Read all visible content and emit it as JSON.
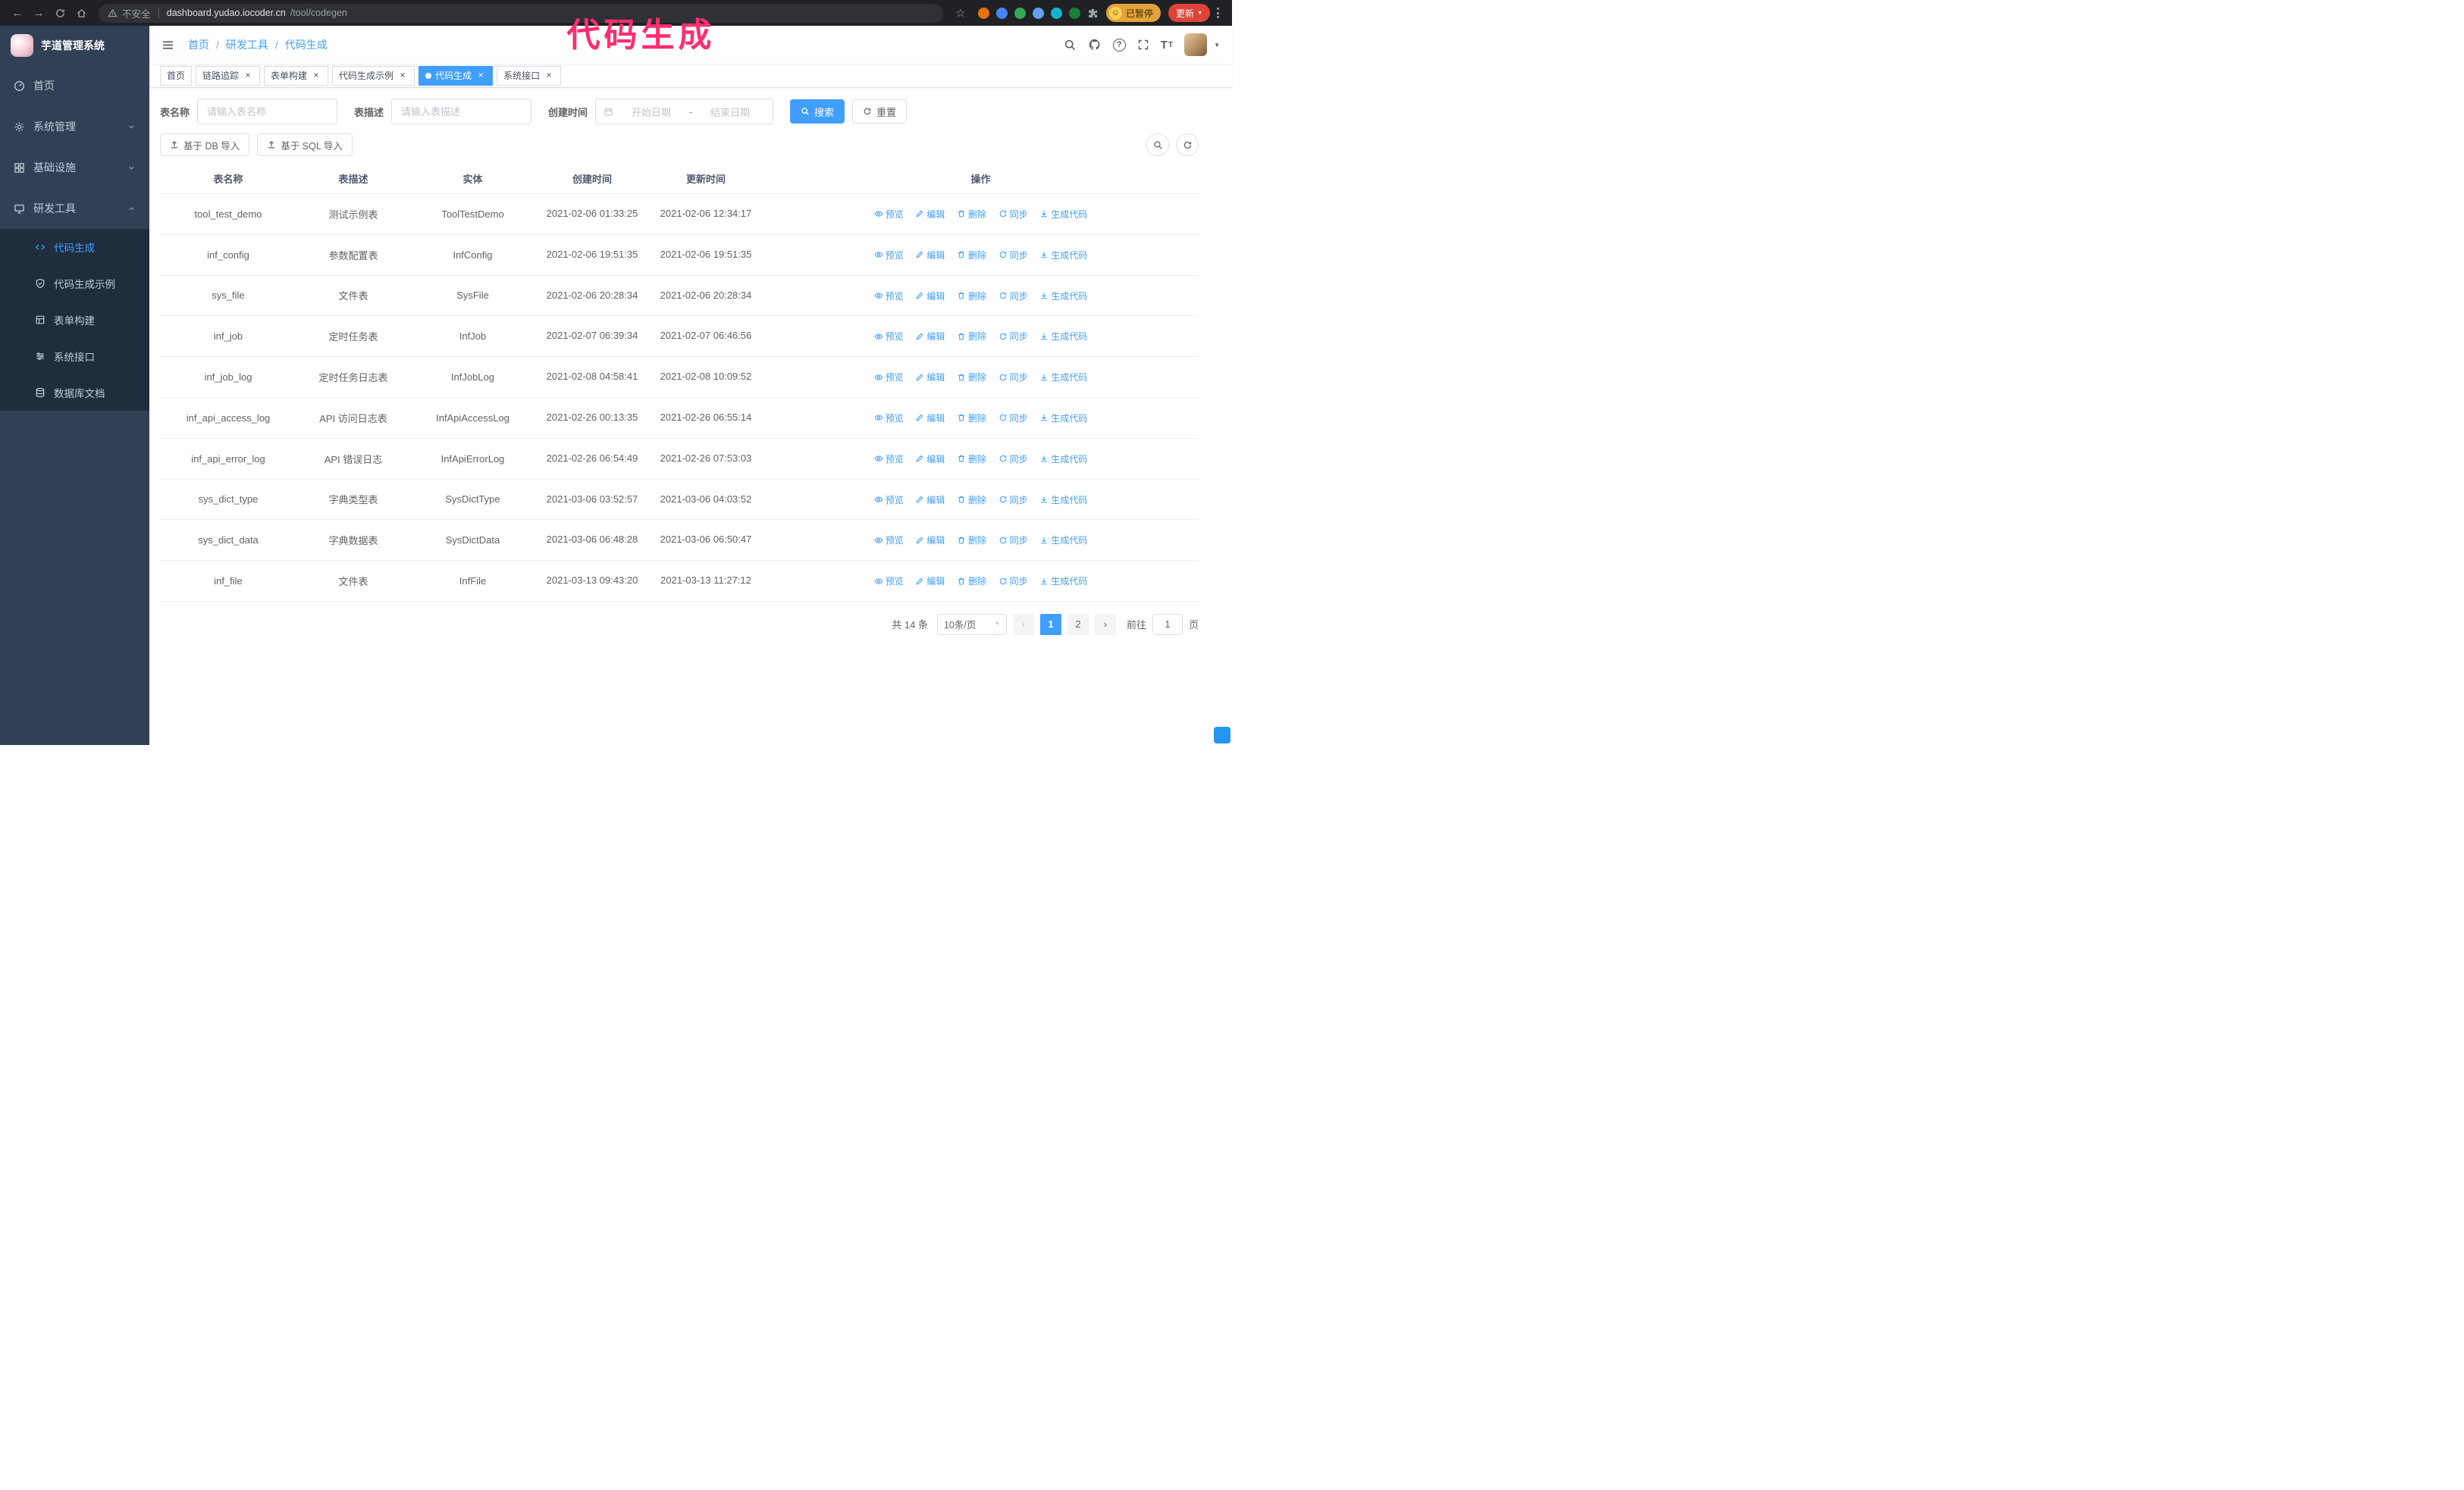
{
  "annotation": {
    "text": "代码生成",
    "color": "#ff2e6e"
  },
  "colors": {
    "primary": "#409eff",
    "sidebar": "#304156",
    "submenu": "#1f2d3d",
    "update_red": "#dd4437",
    "annotation_pink": "#ff2e6e"
  },
  "glyphs": {
    "back": "←",
    "forward": "→",
    "star": "☆",
    "pipe": "|",
    "close": "×",
    "help": "?",
    "slash": "/",
    "caret": "▼",
    "prev": "‹",
    "next": "›",
    "smiley": "☺",
    "font_large": "T",
    "font_small": "T"
  },
  "browser": {
    "security_warning": "不安全",
    "url_host": "dashboard.yudao.iocoder.cn",
    "url_path": "/tool/codegen",
    "profile_status": "已暂停",
    "update_label": "更新"
  },
  "sidebar": {
    "logo_title": "芋道管理系统",
    "items": [
      {
        "label": "首页"
      },
      {
        "label": "系统管理",
        "expandable": true
      },
      {
        "label": "基础设施",
        "expandable": true
      },
      {
        "label": "研发工具",
        "expandable": true,
        "expanded": true
      }
    ],
    "submenu": [
      {
        "label": "代码生成",
        "active": true
      },
      {
        "label": "代码生成示例"
      },
      {
        "label": "表单构建"
      },
      {
        "label": "系统接口"
      },
      {
        "label": "数据库文档"
      }
    ]
  },
  "navbar": {
    "breadcrumb": [
      {
        "label": "首页"
      },
      {
        "label": "研发工具"
      },
      {
        "label": "代码生成"
      }
    ]
  },
  "tabs": [
    {
      "label": "首页",
      "closable": false,
      "active": false
    },
    {
      "label": "链路追踪",
      "closable": true,
      "active": false
    },
    {
      "label": "表单构建",
      "closable": true,
      "active": false
    },
    {
      "label": "代码生成示例",
      "closable": true,
      "active": false
    },
    {
      "label": "代码生成",
      "closable": true,
      "active": true
    },
    {
      "label": "系统接口",
      "closable": true,
      "active": false
    }
  ],
  "filters": {
    "table_name_label": "表名称",
    "table_name_placeholder": "请输入表名称",
    "table_desc_label": "表描述",
    "table_desc_placeholder": "请输入表描述",
    "create_time_label": "创建时间",
    "start_date_placeholder": "开始日期",
    "range_separator": "-",
    "end_date_placeholder": "结束日期",
    "search_button": "搜索",
    "reset_button": "重置"
  },
  "toolbar": {
    "import_db": "基于 DB 导入",
    "import_sql": "基于 SQL 导入"
  },
  "table": {
    "columns": [
      "表名称",
      "表描述",
      "实体",
      "创建时间",
      "更新时间",
      "操作"
    ],
    "actions": [
      "预览",
      "编辑",
      "删除",
      "同步",
      "生成代码"
    ],
    "rows": [
      {
        "name": "tool_test_demo",
        "desc": "测试示例表",
        "entity": "ToolTestDemo",
        "created": "2021-02-06 01:33:25",
        "updated": "2021-02-06 12:34:17"
      },
      {
        "name": "inf_config",
        "desc": "参数配置表",
        "entity": "InfConfig",
        "created": "2021-02-06 19:51:35",
        "updated": "2021-02-06 19:51:35"
      },
      {
        "name": "sys_file",
        "desc": "文件表",
        "entity": "SysFile",
        "created": "2021-02-06 20:28:34",
        "updated": "2021-02-06 20:28:34"
      },
      {
        "name": "inf_job",
        "desc": "定时任务表",
        "entity": "InfJob",
        "created": "2021-02-07 06:39:34",
        "updated": "2021-02-07 06:46:56"
      },
      {
        "name": "inf_job_log",
        "desc": "定时任务日志表",
        "entity": "InfJobLog",
        "created": "2021-02-08 04:58:41",
        "updated": "2021-02-08 10:09:52"
      },
      {
        "name": "inf_api_access_log",
        "desc": "API 访问日志表",
        "entity": "InfApiAccessLog",
        "created": "2021-02-26 00:13:35",
        "updated": "2021-02-26 06:55:14"
      },
      {
        "name": "inf_api_error_log",
        "desc": "API 错误日志",
        "entity": "InfApiErrorLog",
        "created": "2021-02-26 06:54:49",
        "updated": "2021-02-26 07:53:03"
      },
      {
        "name": "sys_dict_type",
        "desc": "字典类型表",
        "entity": "SysDictType",
        "created": "2021-03-06 03:52:57",
        "updated": "2021-03-06 04:03:52"
      },
      {
        "name": "sys_dict_data",
        "desc": "字典数据表",
        "entity": "SysDictData",
        "created": "2021-03-06 06:48:28",
        "updated": "2021-03-06 06:50:47"
      },
      {
        "name": "inf_file",
        "desc": "文件表",
        "entity": "InfFile",
        "created": "2021-03-13 09:43:20",
        "updated": "2021-03-13 11:27:12"
      }
    ]
  },
  "pagination": {
    "total": "共 14 条",
    "page_size": "10条/页",
    "pages": [
      {
        "label": "1",
        "active": true
      },
      {
        "label": "2",
        "active": false
      }
    ],
    "goto_label": "前往",
    "goto_value": "1",
    "unit_label": "页"
  }
}
